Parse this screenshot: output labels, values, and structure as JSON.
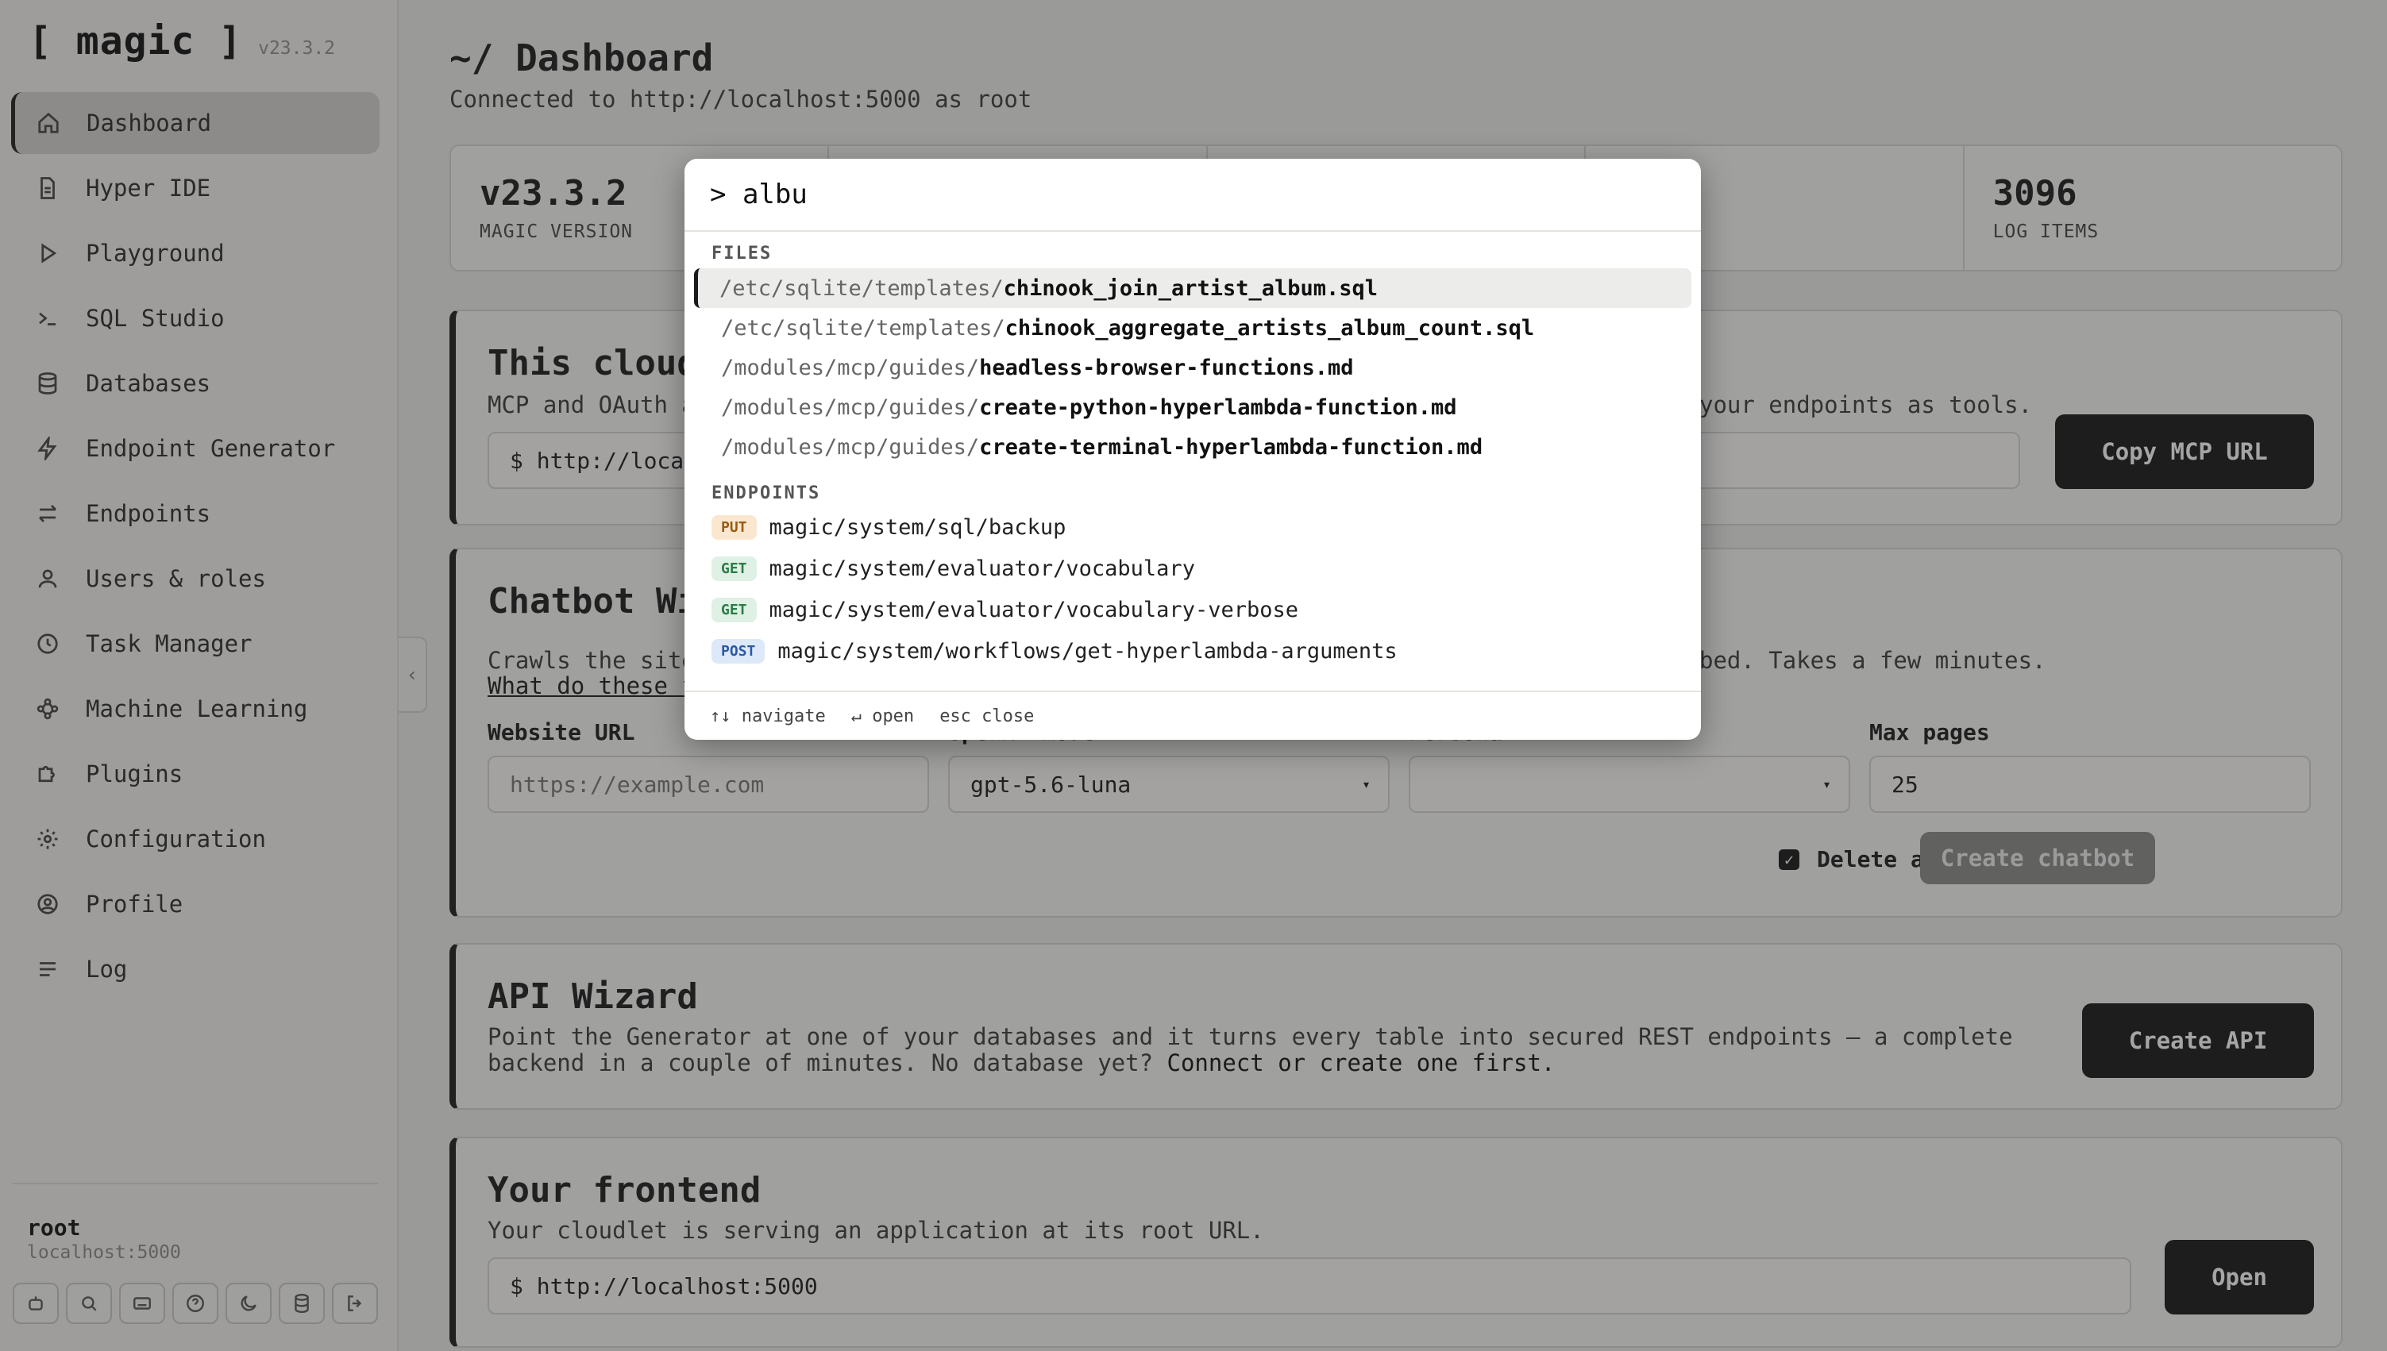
{
  "brand": {
    "logo": "[ magic ]",
    "version": "v23.3.2"
  },
  "sidebar": {
    "items": [
      {
        "label": "Dashboard",
        "icon": "home-icon"
      },
      {
        "label": "Hyper IDE",
        "icon": "file-icon"
      },
      {
        "label": "Playground",
        "icon": "play-icon"
      },
      {
        "label": "SQL Studio",
        "icon": "terminal-icon"
      },
      {
        "label": "Databases",
        "icon": "database-icon"
      },
      {
        "label": "Endpoint Generator",
        "icon": "bolt-icon"
      },
      {
        "label": "Endpoints",
        "icon": "arrows-icon"
      },
      {
        "label": "Users & roles",
        "icon": "user-icon"
      },
      {
        "label": "Task Manager",
        "icon": "clock-icon"
      },
      {
        "label": "Machine Learning",
        "icon": "network-icon"
      },
      {
        "label": "Plugins",
        "icon": "puzzle-icon"
      },
      {
        "label": "Configuration",
        "icon": "gear-icon"
      },
      {
        "label": "Profile",
        "icon": "profile-icon"
      },
      {
        "label": "Log",
        "icon": "list-icon"
      }
    ],
    "footer": {
      "user": "root",
      "host": "localhost:5000",
      "buttons": [
        "robot-icon",
        "search-icon",
        "keyboard-icon",
        "help-icon",
        "moon-icon",
        "database-icon",
        "logout-icon"
      ]
    }
  },
  "header": {
    "title": "~/ Dashboard",
    "subtitle": "Connected to http://localhost:5000 as root"
  },
  "stats": [
    {
      "value": "v23.3.2",
      "label": "MAGIC VERSION"
    },
    {
      "value": "",
      "label": ""
    },
    {
      "value": "",
      "label": ""
    },
    {
      "value": "",
      "label": ""
    },
    {
      "value": "3096",
      "label": "LOG ITEMS"
    }
  ],
  "mcp": {
    "title": "This cloud",
    "desc_left": "MCP and OAuth a",
    "desc_right": "your endpoints as tools.",
    "url": "$ http://local",
    "button": "Copy MCP URL"
  },
  "chatbot": {
    "title": "Chatbot Wi",
    "desc_left": "Crawls the site",
    "desc_right": "bed. Takes a few minutes.",
    "link": "What do these f",
    "url_label": "Website URL",
    "url_placeholder": "https://example.com",
    "model_label": "OpenAI model",
    "model_value": "gpt-5.6-luna",
    "persona_label": "Persona",
    "persona_value": "",
    "pages_label": "Max pages",
    "pages_value": "25",
    "delete_label": "Delete after 7 days",
    "button": "Create chatbot"
  },
  "api": {
    "title": "API Wizard",
    "line1": "Point the Generator at one of your databases and it turns every table into secured REST endpoints — a complete",
    "line2a": "backend in a couple of minutes. No database yet? ",
    "line2b": "Connect or create one first.",
    "button": "Create API"
  },
  "frontend": {
    "title": "Your frontend",
    "desc": "Your cloudlet is serving an application at its root URL.",
    "url": "$ http://localhost:5000",
    "button": "Open"
  },
  "palette": {
    "query": "> albu",
    "files_label": "FILES",
    "files": [
      {
        "path": "/etc/sqlite/templates/",
        "name": "chinook_join_artist_album.sql"
      },
      {
        "path": "/etc/sqlite/templates/",
        "name": "chinook_aggregate_artists_album_count.sql"
      },
      {
        "path": "/modules/mcp/guides/",
        "name": "headless-browser-functions.md"
      },
      {
        "path": "/modules/mcp/guides/",
        "name": "create-python-hyperlambda-function.md"
      },
      {
        "path": "/modules/mcp/guides/",
        "name": "create-terminal-hyperlambda-function.md"
      }
    ],
    "endpoints_label": "ENDPOINTS",
    "endpoints": [
      {
        "method": "PUT",
        "path": "magic/system/sql/backup"
      },
      {
        "method": "GET",
        "path": "magic/system/evaluator/vocabulary"
      },
      {
        "method": "GET",
        "path": "magic/system/evaluator/vocabulary-verbose"
      },
      {
        "method": "POST",
        "path": "magic/system/workflows/get-hyperlambda-arguments"
      }
    ],
    "hints": [
      "↑↓ navigate",
      "↵ open",
      "esc close"
    ]
  },
  "colors": {
    "accent": "#151515",
    "overlay": "rgba(40,40,40,0.42)",
    "put": "#fbe7cf",
    "get": "#dff0e4",
    "post": "#dde8f8"
  }
}
